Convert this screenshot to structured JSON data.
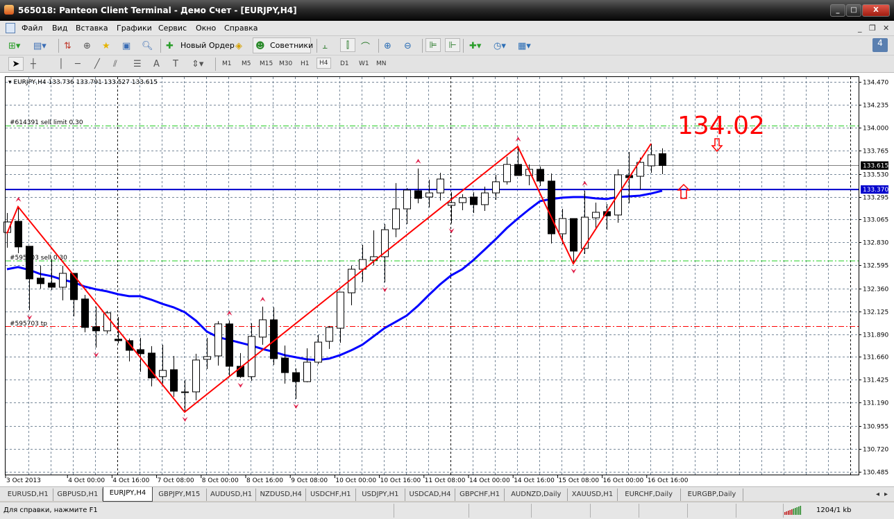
{
  "window": {
    "title": "565018: Panteon Client Terminal - Демо Счет - [EURJPY,H4]",
    "minimize": "_",
    "maximize": "□",
    "close": "X"
  },
  "menu": [
    "Файл",
    "Вид",
    "Вставка",
    "Графики",
    "Сервис",
    "Окно",
    "Справка"
  ],
  "mdi": {
    "minimize": "_",
    "restore": "❐",
    "close": "✕"
  },
  "toolbar": {
    "new_order": "Новый Ордер",
    "experts": "Советники",
    "notifications": "4"
  },
  "timeframes": [
    "M1",
    "M5",
    "M15",
    "M30",
    "H1",
    "H4",
    "D1",
    "W1",
    "MN"
  ],
  "selected_timeframe": "H4",
  "chart": {
    "header": "EURJPY,H4  133.736 133.791 133.527 133.615",
    "price_ticks": [
      "134.470",
      "134.235",
      "134.000",
      "133.765",
      "133.530",
      "133.295",
      "133.065",
      "132.830",
      "132.595",
      "132.360",
      "132.125",
      "131.890",
      "131.660",
      "131.425",
      "131.190",
      "130.955",
      "130.720",
      "130.485"
    ],
    "time_labels": [
      "3 Oct 2013",
      "4 Oct 00:00",
      "4 Oct 16:00",
      "7 Oct 08:00",
      "8 Oct 00:00",
      "8 Oct 16:00",
      "9 Oct 08:00",
      "10 Oct 00:00",
      "10 Oct 16:00",
      "11 Oct 08:00",
      "14 Oct 00:00",
      "14 Oct 16:00",
      "15 Oct 08:00",
      "16 Oct 00:00",
      "16 Oct 16:00"
    ],
    "bid_label": "133.615",
    "hline_label": "133.370",
    "order_labels": {
      "sell_limit": "#614391 sell limit 0.30",
      "sell": "#595703 sell 0.30",
      "tp": "#595703 tp"
    },
    "annotation": "134.02",
    "colors": {
      "bull": "#ffffff",
      "bear": "#000000",
      "ma": "#0000ff",
      "zigzag": "#ff0000",
      "order": "#22cc22",
      "tp": "#ff0000",
      "fractal": "#e0204a"
    }
  },
  "chart_data": {
    "type": "candlestick",
    "symbol": "EURJPY",
    "timeframe": "H4",
    "ylim": [
      130.485,
      134.47
    ],
    "candles": [
      [
        132.931,
        133.13,
        132.775,
        133.038
      ],
      [
        133.045,
        133.194,
        132.719,
        132.783
      ],
      [
        132.79,
        132.79,
        132.137,
        132.456
      ],
      [
        132.464,
        132.591,
        132.357,
        132.407
      ],
      [
        132.414,
        132.662,
        132.343,
        132.371
      ],
      [
        132.371,
        132.591,
        132.237,
        132.513
      ],
      [
        132.513,
        132.513,
        132.074,
        132.244
      ],
      [
        132.251,
        132.293,
        131.911,
        131.96
      ],
      [
        131.967,
        132.173,
        131.755,
        131.925
      ],
      [
        131.925,
        132.13,
        131.896,
        132.109
      ],
      [
        131.84,
        132.066,
        131.797,
        131.825
      ],
      [
        131.825,
        131.847,
        131.613,
        131.726
      ],
      [
        131.733,
        131.854,
        131.506,
        131.691
      ],
      [
        131.698,
        131.769,
        131.357,
        131.443
      ],
      [
        131.457,
        131.783,
        131.386,
        131.521
      ],
      [
        131.528,
        131.669,
        131.251,
        131.308
      ],
      [
        131.301,
        131.421,
        131.095,
        131.298
      ],
      [
        131.301,
        131.691,
        131.216,
        131.627
      ],
      [
        131.634,
        131.854,
        131.535,
        131.662
      ],
      [
        131.669,
        132.024,
        131.57,
        131.996
      ],
      [
        131.996,
        132.031,
        131.457,
        131.563
      ],
      [
        131.563,
        131.698,
        131.443,
        131.457
      ],
      [
        131.457,
        132.003,
        131.414,
        131.868
      ],
      [
        131.861,
        132.173,
        131.783,
        132.038
      ],
      [
        132.038,
        132.165,
        131.577,
        131.641
      ],
      [
        131.647,
        131.775,
        131.386,
        131.498
      ],
      [
        131.498,
        131.541,
        131.229,
        131.406
      ],
      [
        131.406,
        131.747,
        131.399,
        131.605
      ],
      [
        131.605,
        131.881,
        131.584,
        131.81
      ],
      [
        131.818,
        131.974,
        131.74,
        131.96
      ],
      [
        131.952,
        132.321,
        131.803,
        132.321
      ],
      [
        132.314,
        132.591,
        132.186,
        132.555
      ],
      [
        132.555,
        132.803,
        132.427,
        132.654
      ],
      [
        132.647,
        132.952,
        132.598,
        132.683
      ],
      [
        132.683,
        133.016,
        132.42,
        132.959
      ],
      [
        132.967,
        133.435,
        132.882,
        133.172
      ],
      [
        133.172,
        133.385,
        133.016,
        133.364
      ],
      [
        133.357,
        133.584,
        133.229,
        133.279
      ],
      [
        133.293,
        133.47,
        133.186,
        133.335
      ],
      [
        133.335,
        133.541,
        133.257,
        133.477
      ],
      [
        133.208,
        133.342,
        133.023,
        133.236
      ],
      [
        133.236,
        133.321,
        133.158,
        133.286
      ],
      [
        133.293,
        133.342,
        133.13,
        133.215
      ],
      [
        133.215,
        133.399,
        133.151,
        133.335
      ],
      [
        133.335,
        133.52,
        133.264,
        133.449
      ],
      [
        133.449,
        133.704,
        133.42,
        133.626
      ],
      [
        133.626,
        133.81,
        133.513,
        133.513
      ],
      [
        133.513,
        133.626,
        133.413,
        133.576
      ],
      [
        133.576,
        133.605,
        133.406,
        133.456
      ],
      [
        133.456,
        133.534,
        132.818,
        132.917
      ],
      [
        132.917,
        133.172,
        132.81,
        133.073
      ],
      [
        133.073,
        133.073,
        132.612,
        132.74
      ],
      [
        132.768,
        133.357,
        132.711,
        133.087
      ],
      [
        133.08,
        133.236,
        132.967,
        133.137
      ],
      [
        133.144,
        133.222,
        132.959,
        133.101
      ],
      [
        133.109,
        133.576,
        133.03,
        133.52
      ],
      [
        133.513,
        133.754,
        133.229,
        133.491
      ],
      [
        133.505,
        133.697,
        133.371,
        133.647
      ],
      [
        133.612,
        133.839,
        133.541,
        133.725
      ],
      [
        133.736,
        133.791,
        133.527,
        133.615
      ]
    ],
    "ma": [
      132.555,
      132.577,
      132.549,
      132.506,
      132.485,
      132.449,
      132.421,
      132.378,
      132.35,
      132.329,
      132.3,
      132.279,
      132.279,
      132.244,
      132.201,
      132.166,
      132.116,
      132.031,
      131.918,
      131.861,
      131.833,
      131.804,
      131.776,
      131.74,
      131.712,
      131.677,
      131.655,
      131.634,
      131.627,
      131.641,
      131.677,
      131.726,
      131.783,
      131.868,
      131.953,
      132.017,
      132.081,
      132.18,
      132.293,
      132.4,
      132.492,
      132.555,
      132.648,
      132.754,
      132.861,
      132.974,
      133.073,
      133.165,
      133.251,
      133.272,
      133.286,
      133.293,
      133.293,
      133.279,
      133.272,
      133.293,
      133.3,
      133.307,
      133.329,
      133.357
    ],
    "zigzag": [
      [
        0,
        132.92
      ],
      [
        1,
        133.194
      ],
      [
        16,
        131.095
      ],
      [
        46,
        133.81
      ],
      [
        51,
        132.612
      ],
      [
        58,
        133.839
      ]
    ],
    "fractals_up": [
      1,
      20,
      23,
      37,
      46,
      52
    ],
    "fractals_down": [
      2,
      8,
      16,
      21,
      26,
      34,
      40,
      51
    ],
    "levels": {
      "bid": 133.615,
      "hline": 133.37,
      "sell_limit": 134.02,
      "sell": 132.64,
      "tp": 131.97
    }
  },
  "tabs": [
    "EURUSD,H1",
    "GBPUSD,H1",
    "EURJPY,H4",
    "GBPJPY,M15",
    "AUDUSD,H1",
    "NZDUSD,H4",
    "USDCHF,H1",
    "USDJPY,H1",
    "USDCAD,H4",
    "GBPCHF,H1",
    "AUDNZD,Daily",
    "XAUUSD,H1",
    "EURCHF,Daily",
    "EURGBP,Daily"
  ],
  "active_tab": "EURJPY,H4",
  "status": {
    "help": "Для справки, нажмите F1",
    "traffic": "1204/1 kb"
  }
}
